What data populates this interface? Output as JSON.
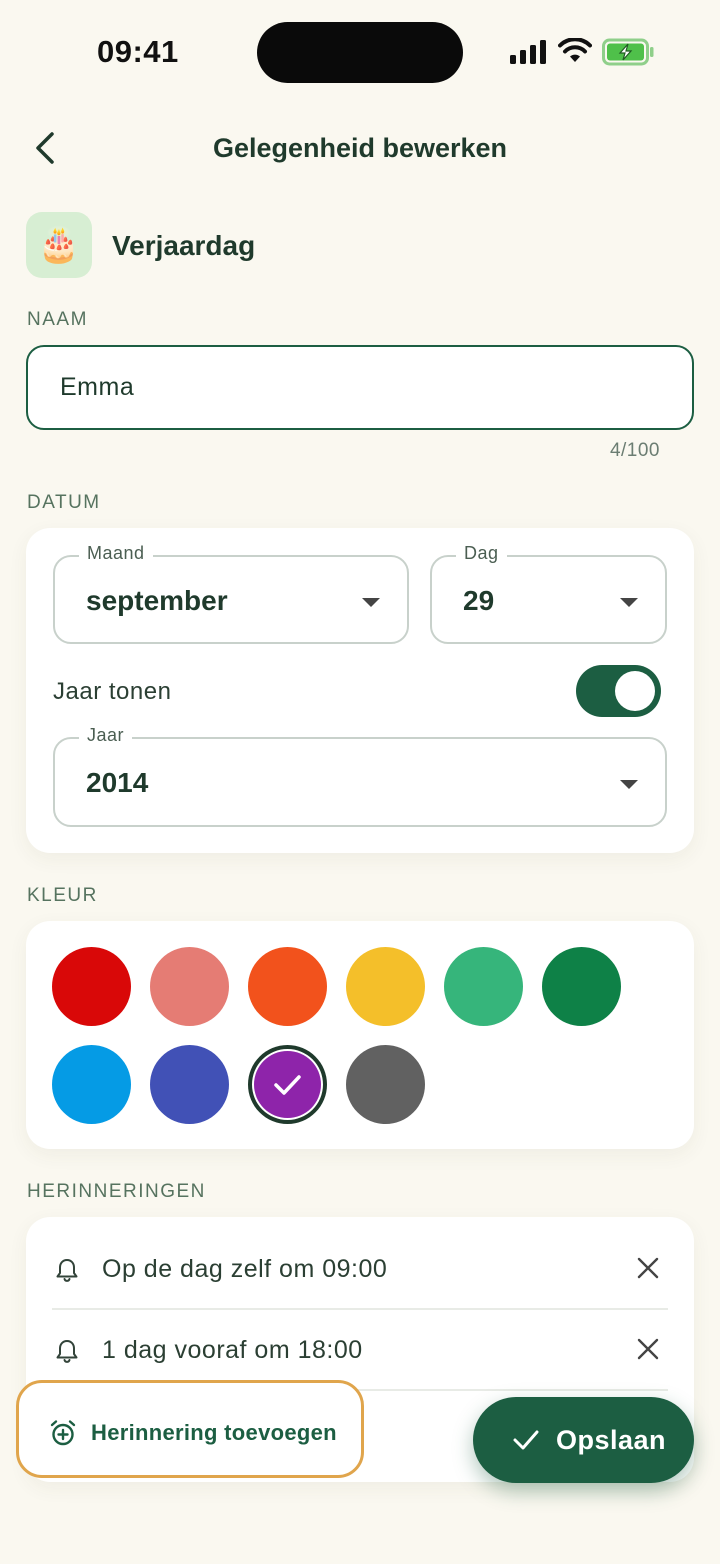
{
  "status_bar": {
    "time": "09:41"
  },
  "header": {
    "title": "Gelegenheid bewerken"
  },
  "occasion": {
    "emoji": "🎂",
    "type_label": "Verjaardag"
  },
  "name_section": {
    "label": "NAAM",
    "value": "Emma",
    "counter": "4/100"
  },
  "date_section": {
    "label": "DATUM",
    "month": {
      "label": "Maand",
      "value": "september"
    },
    "day": {
      "label": "Dag",
      "value": "29"
    },
    "show_year": {
      "label": "Jaar tonen",
      "enabled": true
    },
    "year": {
      "label": "Jaar",
      "value": "2014"
    }
  },
  "color_section": {
    "label": "KLEUR",
    "colors": [
      "#d90808",
      "#e57c74",
      "#f2521c",
      "#f4bf2a",
      "#36b57b",
      "#0e8147",
      "#059be5",
      "#4151b6",
      "#8e24aa",
      "#616161"
    ],
    "selected_index": 8
  },
  "reminders_section": {
    "label": "HERINNERINGEN",
    "items": [
      {
        "text": "Op de dag zelf om 09:00"
      },
      {
        "text": "1 dag vooraf om 18:00"
      }
    ],
    "add_label": "Herinnering toevoegen"
  },
  "save_button": {
    "label": "Opslaan"
  }
}
